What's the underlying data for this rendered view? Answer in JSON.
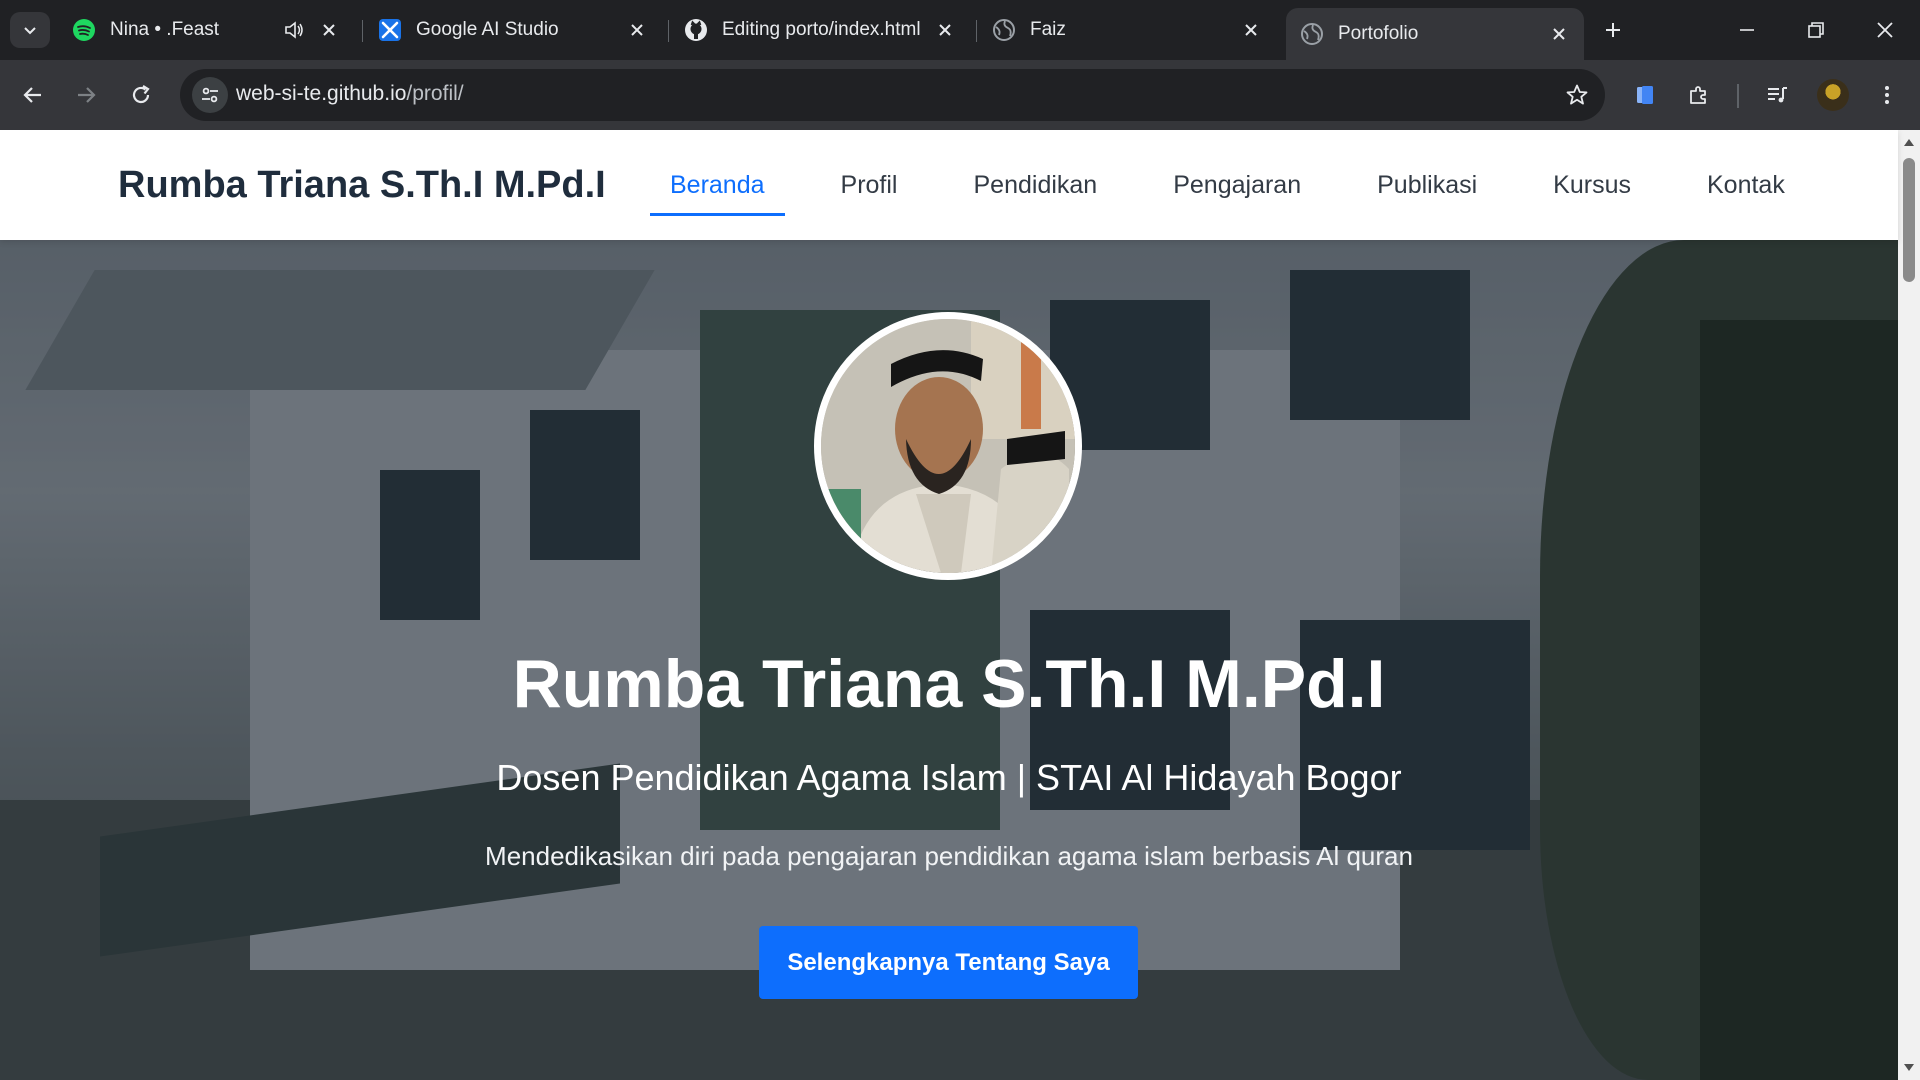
{
  "browser": {
    "tabs": [
      {
        "title": "Nina • .Feast",
        "icon": "spotify-icon",
        "audio": true
      },
      {
        "title": "Google AI Studio",
        "icon": "google-ai-studio-icon"
      },
      {
        "title": "Editing porto/index.html",
        "icon": "github-icon"
      },
      {
        "title": "Faiz",
        "icon": "globe-icon"
      },
      {
        "title": "Portofolio",
        "icon": "globe-icon",
        "active": true
      }
    ],
    "address": {
      "host": "web-si-te.github.io",
      "path": "/profil/"
    },
    "colors": {
      "frame": "#202124",
      "toolbar": "#35363a",
      "omnibox": "#202124",
      "text": "#e8eaed"
    }
  },
  "site": {
    "brand": "Rumba Triana S.Th.I M.Pd.I",
    "nav": [
      {
        "label": "Beranda",
        "active": true
      },
      {
        "label": "Profil"
      },
      {
        "label": "Pendidikan"
      },
      {
        "label": "Pengajaran"
      },
      {
        "label": "Publikasi"
      },
      {
        "label": "Kursus"
      },
      {
        "label": "Kontak"
      }
    ],
    "hero": {
      "name": "Rumba Triana S.Th.I M.Pd.I",
      "role": "Dosen Pendidikan Agama Islam | STAI Al Hidayah Bogor",
      "tagline": "Mendedikasikan diri pada pengajaran pendidikan agama islam berbasis Al quran",
      "cta": "Selengkapnya Tentang Saya"
    },
    "colors": {
      "accent": "#0d6efd",
      "brand_text": "#1f2d3d"
    }
  }
}
